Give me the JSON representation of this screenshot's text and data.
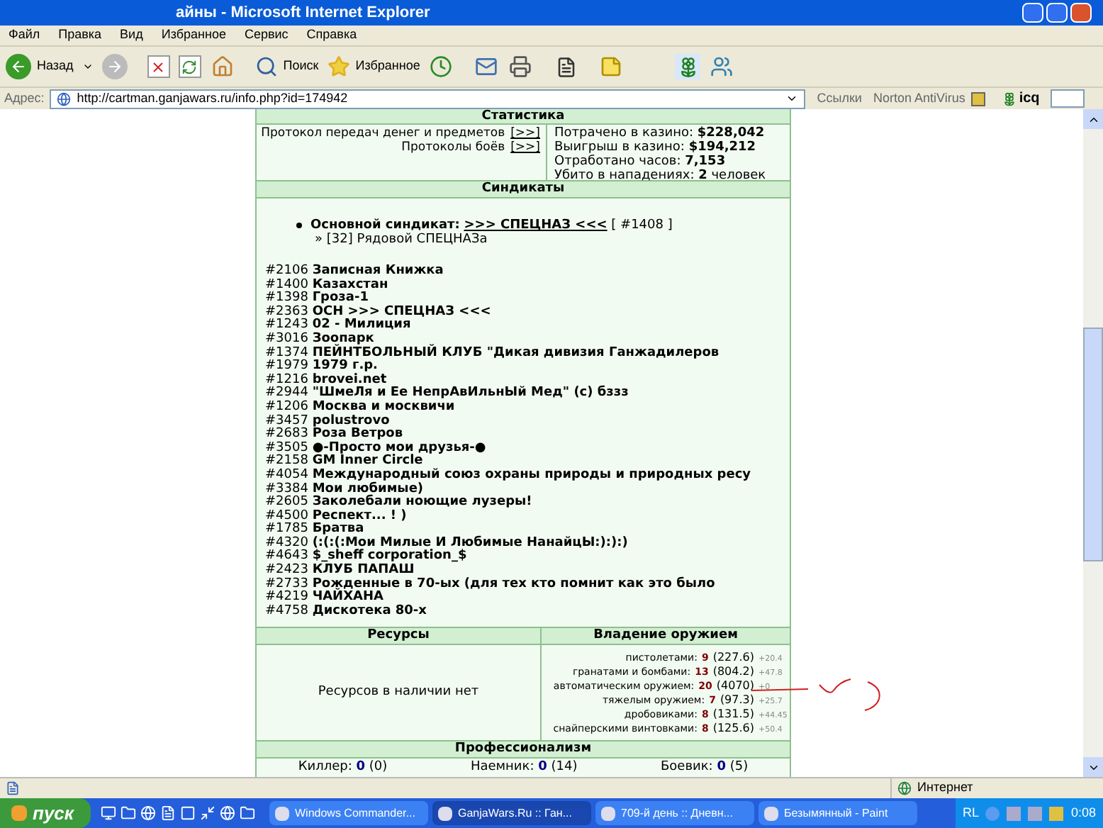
{
  "window": {
    "title": "айны - Microsoft Internet Explorer"
  },
  "menu": [
    "Файл",
    "Правка",
    "Вид",
    "Избранное",
    "Сервис",
    "Справка"
  ],
  "toolbar": {
    "back": "Назад",
    "search": "Поиск",
    "favorites": "Избранное"
  },
  "address": {
    "label": "Адрес:",
    "url": "http://cartman.ganjawars.ru/info.php?id=174942",
    "links": "Ссылки",
    "norton": "Norton AntiVirus",
    "icq": "icq"
  },
  "statistics": {
    "title": "Статистика",
    "protocols": [
      {
        "label": "Протокол передач денег и предметов",
        "link": "[>>]"
      },
      {
        "label": "Протоколы боёв",
        "link": "[>>]"
      }
    ],
    "figures": [
      "Потрачено в казино: **$228,042**",
      "Выигрыш в казино: **$194,212**",
      "Отработано часов: **7,153**",
      "Убито в нападениях: **2** человек"
    ]
  },
  "syndicates": {
    "title": "Синдикаты",
    "main_label": "Основной синдикат:",
    "main_link": ">>> СПЕЦНАЗ <<<",
    "main_id": "[ #1408 ]",
    "rank": "» [32] Рядовой СПЕЦНАЗа",
    "list": [
      "#2106 **Записная Книжка**",
      "#1400 **Казахстан**",
      "#1398 **Гроза-1**",
      "#2363 **ОСН >>> СПЕЦНАЗ <<<**",
      "#1243 **02 - Милиция**",
      "#3016 **Зоопарк**",
      "#1374 **ПЕЙНТБОЛЬНЫЙ КЛУБ \"Дикая дивизия Ганжадилеров**",
      "#1979 **1979 г.р.**",
      "#1216 **brovei.net**",
      "#2944 **\"ШмеЛя и Ее НепрАвИльнЫй Мед\" (c) бззз**",
      "#1206 **Москва и москвичи**",
      "#3457 **polustrovo**",
      "#2683 **Роза Ветров**",
      "#3505 **●-Просто мои друзья-●**",
      "#2158 **GM Inner Circle**",
      "#4054 **Международный союз охраны природы и природных ресу**",
      "#3384 **Мои любимые)**",
      "#2605 **Заколебали ноющие лузеры!**",
      "#4500 **Респект... ! )**",
      "#1785 **Братва**",
      "#4320 **(:(:(:Мои Милые И Любимые НанайцЫ:):):)**",
      "#4643 **$_sheff corporation_$**",
      "#2423 **КЛУБ ПАПАШ**",
      "#2733 **Рожденные в 70-ых (для тех кто помнит как это было**",
      "#4219 **ЧАЙХАНА**",
      "#4758 **Дискотека 80-х**"
    ]
  },
  "resources": {
    "title": "Ресурсы",
    "text": "Ресурсов в наличии нет"
  },
  "weapons": {
    "title": "Владение оружием",
    "rows": [
      {
        "label": "пистолетами:",
        "value": "9",
        "points": "(227.6)",
        "bonus": "+20.4"
      },
      {
        "label": "гранатами и бомбами:",
        "value": "13",
        "points": "(804.2)",
        "bonus": "+47.8"
      },
      {
        "label": "автоматическим оружием:",
        "value": "20",
        "points": "(4070)",
        "bonus": "+0"
      },
      {
        "label": "тяжелым оружием:",
        "value": "7",
        "points": "(97.3)",
        "bonus": "+25.7"
      },
      {
        "label": "дробовиками:",
        "value": "8",
        "points": "(131.5)",
        "bonus": "+44.45"
      },
      {
        "label": "снайперскими винтовками:",
        "value": "8",
        "points": "(125.6)",
        "bonus": "+50.4"
      }
    ]
  },
  "professionalism": {
    "title": "Профессионализм",
    "items": [
      "Киллер: **0** (0)",
      "Наемник: **0** (14)",
      "Боевик: **0** (5)"
    ]
  },
  "status_bar": {
    "zone": "Интернет"
  },
  "taskbar": {
    "start": "пуск",
    "tasks": [
      {
        "label": "Windows Commander...",
        "selected": false
      },
      {
        "label": "GanjaWars.Ru :: Ган...",
        "selected": true
      },
      {
        "label": "709-й день :: Дневн...",
        "selected": false
      },
      {
        "label": "Безымянный - Paint",
        "selected": false
      }
    ],
    "tray": "RL",
    "clock": "0:08"
  }
}
